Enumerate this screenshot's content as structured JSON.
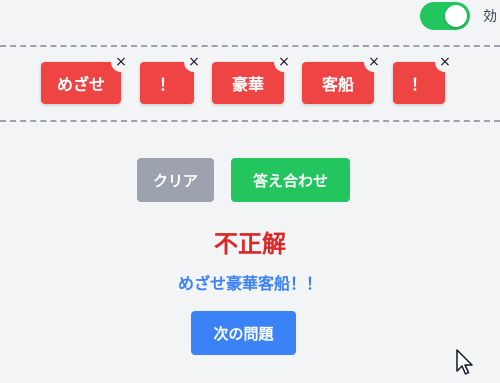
{
  "toggle": {
    "label": "効",
    "on": true,
    "on_color": "#22c55e"
  },
  "chips": [
    {
      "text": "めざせ",
      "remove": "×"
    },
    {
      "text": "！",
      "remove": "×"
    },
    {
      "text": "豪華",
      "remove": "×"
    },
    {
      "text": "客船",
      "remove": "×"
    },
    {
      "text": "！",
      "remove": "×"
    }
  ],
  "buttons": {
    "clear": "クリア",
    "check": "答え合わせ",
    "next": "次の問題"
  },
  "result": {
    "text": "不正解",
    "color": "#dc2626"
  },
  "answer": {
    "text": "めざせ豪華客船！！",
    "color": "#3b82f6"
  },
  "colors": {
    "chip": "#ef4444",
    "clear_button": "#9ca3af",
    "check_button": "#22c55e",
    "next_button": "#3b82f6",
    "background": "#f3f4f6"
  }
}
